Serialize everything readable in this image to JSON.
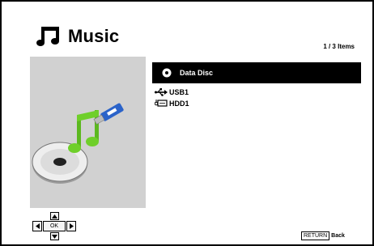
{
  "header": {
    "title": "Music",
    "icon": "music-note-icon",
    "item_count": "1 / 3 Items"
  },
  "list": {
    "items": [
      {
        "label": "Data Disc",
        "icon": "disc-icon",
        "selected": true
      },
      {
        "label": "USB1",
        "icon": "usb-icon",
        "selected": false
      },
      {
        "label": "HDD1",
        "icon": "hdd-icon",
        "selected": false
      }
    ]
  },
  "nav": {
    "ok_label": "OK"
  },
  "footer": {
    "return_key": "RETURN",
    "return_label": "Back"
  },
  "colors": {
    "selection_bg": "#000000",
    "preview_bg": "#d1d1d1",
    "note_green": "#6fcf2a",
    "usb_blue": "#2b63c9"
  }
}
